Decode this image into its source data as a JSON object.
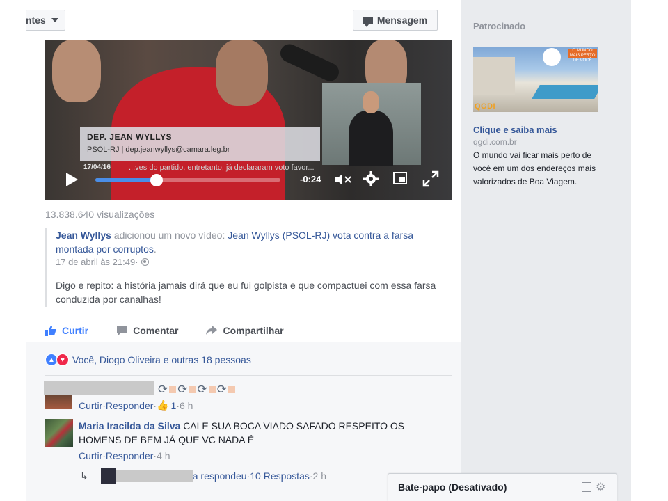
{
  "header": {
    "friends_label": "ntes",
    "message_label": "Mensagem"
  },
  "video": {
    "lower_third_name": "DEP. JEAN WYLLYS",
    "lower_third_sub": "PSOL-RJ | dep.jeanwyllys@camara.leg.br",
    "date": "17/04/16",
    "ticker": "...ves do partido, entretanto, já declararam voto favor...",
    "time_remaining": "-0:24",
    "progress_fraction": 0.33
  },
  "post": {
    "views": "13.838.640 visualizações",
    "shared_author": "Jean Wyllys",
    "shared_action": " adicionou um novo vídeo: ",
    "shared_link": "Jean Wyllys (PSOL-RJ) vota contra a farsa montada por corruptos",
    "shared_end": ".",
    "shared_date": "17 de abril às 21:49",
    "shared_sep": " · ",
    "shared_body": "Digo e repito: a história jamais dirá que eu fui golpista e que compactuei com essa farsa conduzida por canalhas!"
  },
  "actions": {
    "like": "Curtir",
    "comment": "Comentar",
    "share": "Compartilhar"
  },
  "reactions": {
    "text": "Você, Diogo Oliveira e outras 18 pessoas"
  },
  "comments": {
    "first": {
      "like": "Curtir",
      "sep": " · ",
      "reply": "Responder",
      "likes_count": "1",
      "time": "6 h"
    },
    "maria": {
      "author": "Maria Iracilda da Silva",
      "text": "CALE SUA BOCA VIADO SAFADO RESPEITO OS HOMENS DE BEM JÁ QUE VC NADA É",
      "like": "Curtir",
      "sep": " · ",
      "reply": "Responder",
      "time": "4 h"
    },
    "reply_summary": {
      "action": "a respondeu",
      "sep": " · ",
      "count": "10 Respostas",
      "time": "2 h"
    }
  },
  "sidebar": {
    "sponsored_title": "Patrocinado",
    "ad_brand_line": "O MUNDO MAIS PERTO DE VOCÊ",
    "ad_logo": "QGDI",
    "ad_title": "Clique e saiba mais",
    "ad_url": "qgdi.com.br",
    "ad_description": "O mundo vai ficar mais perto de você em um dos endereços mais valorizados de Boa Viagem."
  },
  "chat": {
    "label": "Bate-papo (Desativado)"
  },
  "colors": {
    "link": "#365899",
    "like_blue": "#4080ff",
    "love_red": "#f0284a",
    "muted": "#90949c",
    "progress": "#4a8ee8"
  }
}
